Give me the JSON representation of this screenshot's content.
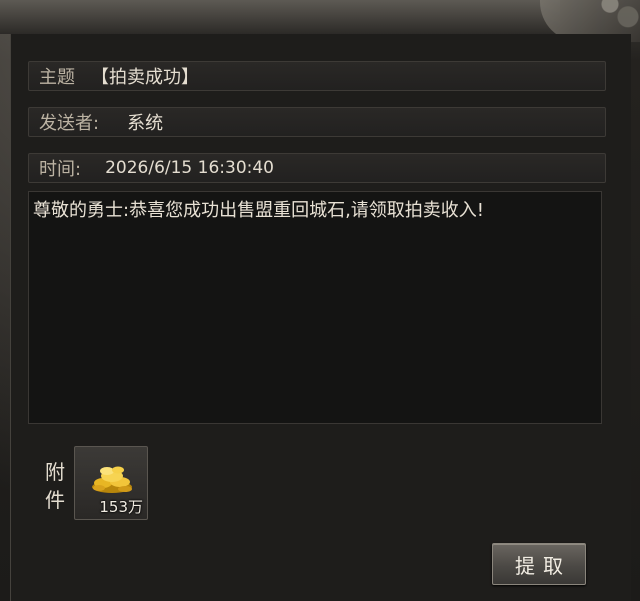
{
  "mail": {
    "subject_label": "主题",
    "subject": "【拍卖成功】",
    "sender_label": "发送者:",
    "sender": "系统",
    "time_label": "时间:",
    "time": "2026/6/15 16:30:40",
    "body": "尊敬的勇士:恭喜您成功出售盟重回城石,请领取拍卖收入!"
  },
  "attachment": {
    "label": "附件",
    "item_icon": "gold-coins-icon",
    "quantity": "153万"
  },
  "actions": {
    "claim_label": "提取"
  }
}
